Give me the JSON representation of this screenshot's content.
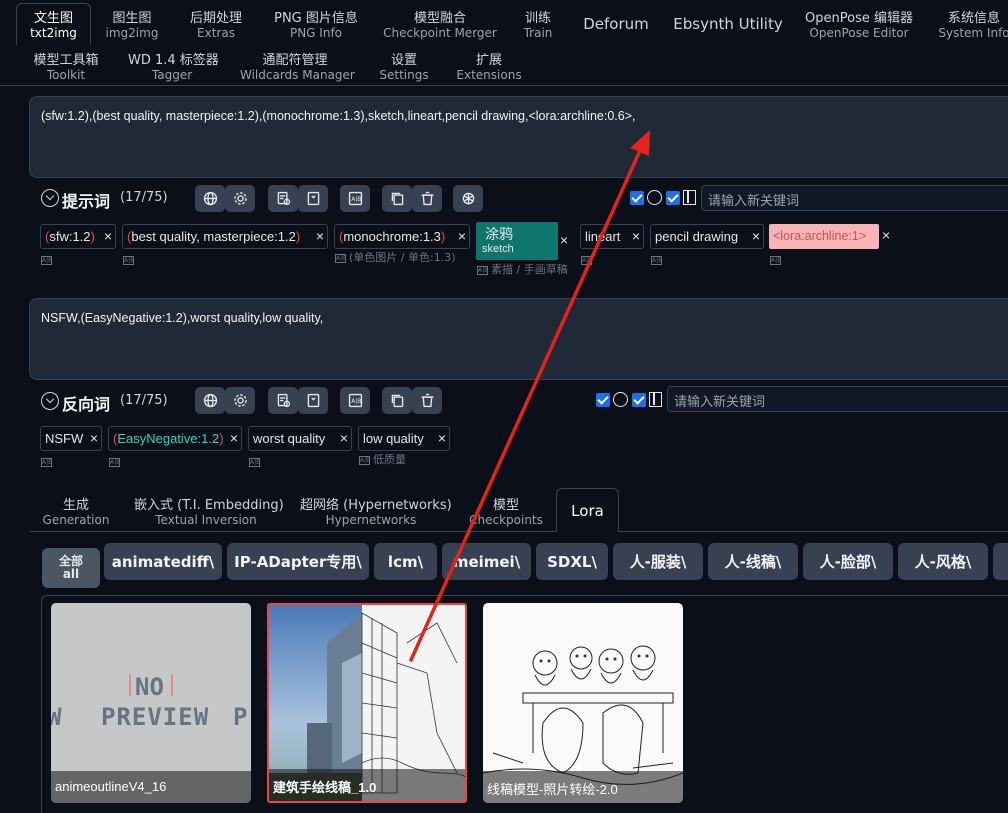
{
  "top_tabs": [
    {
      "zh": "文生图",
      "en": "txt2img"
    },
    {
      "zh": "图生图",
      "en": "img2img"
    },
    {
      "zh": "后期处理",
      "en": "Extras"
    },
    {
      "zh": "PNG 图片信息",
      "en": "PNG Info"
    },
    {
      "zh": "模型融合",
      "en": "Checkpoint Merger"
    },
    {
      "zh": "训练",
      "en": "Train"
    },
    {
      "zh": "Deforum",
      "en": ""
    },
    {
      "zh": "Ebsynth Utility",
      "en": ""
    },
    {
      "zh": "OpenPose 编辑器",
      "en": "OpenPose Editor"
    },
    {
      "zh": "系统信息",
      "en": "System Info"
    }
  ],
  "second_tabs": [
    {
      "zh": "模型工具箱",
      "en": "Toolkit"
    },
    {
      "zh": "WD 1.4 标签器",
      "en": "Tagger"
    },
    {
      "zh": "通配符管理",
      "en": "Wildcards Manager"
    },
    {
      "zh": "设置",
      "en": "Settings"
    },
    {
      "zh": "扩展",
      "en": "Extensions"
    }
  ],
  "prompt": {
    "text": "(sfw:1.2),(best quality, masterpiece:1.2),(monochrome:1.3),sketch,lineart,pencil drawing,<lora:archline:0.6>,",
    "label": "提示词",
    "count": "(17/75)",
    "keyword_placeholder": "请输入新关键词",
    "tags": [
      {
        "pre": "(",
        "text": "sfw:1.2",
        "post": ")",
        "sub": ""
      },
      {
        "pre": "(",
        "text": "best quality, masterpiece:1.2",
        "post": ")",
        "sub": ""
      },
      {
        "pre": "(",
        "text": "monochrome:1.3",
        "post": ")",
        "sub": "(单色图片 / 单色:1.3)"
      },
      {
        "pre": "",
        "text": "涂鸦",
        "post": "",
        "sub": "素描 / 手画草稿",
        "en": "sketch"
      },
      {
        "pre": "",
        "text": "lineart",
        "post": "",
        "sub": ""
      },
      {
        "pre": "",
        "text": "pencil drawing",
        "post": "",
        "sub": ""
      },
      {
        "pre": "",
        "text": "<lora:archline:1>",
        "post": "",
        "sub": ""
      }
    ]
  },
  "negative": {
    "text": "NSFW,(EasyNegative:1.2),worst quality,low quality,",
    "label": "反向词",
    "count": "(17/75)",
    "keyword_placeholder": "请输入新关键词",
    "tags": [
      {
        "pre": "",
        "text": "NSFW",
        "post": "",
        "sub": ""
      },
      {
        "pre": "(",
        "text": "EasyNegative:1.2",
        "post": ")",
        "sub": ""
      },
      {
        "pre": "",
        "text": "worst quality",
        "post": "",
        "sub": ""
      },
      {
        "pre": "",
        "text": "low quality",
        "post": "",
        "sub": "低质量"
      }
    ]
  },
  "network_tabs": [
    {
      "zh": "生成",
      "en": "Generation"
    },
    {
      "zh": "嵌入式 (T.I. Embedding)",
      "en": "Textual Inversion"
    },
    {
      "zh": "超网络 (Hypernetworks)",
      "en": "Hypernetworks"
    },
    {
      "zh": "模型",
      "en": "Checkpoints"
    },
    {
      "zh": "Lora",
      "en": ""
    }
  ],
  "categories": {
    "all_zh": "全部",
    "all_en": "all",
    "items": [
      "animatediff\\",
      "IP-ADapter专用\\",
      "lcm\\",
      "meimei\\",
      "SDXL\\",
      "人-服装\\",
      "人-线稿\\",
      "人-脸部\\",
      "人-风格\\"
    ]
  },
  "cards": [
    {
      "name": "animeoutlineV4_16",
      "no_preview_top": "NO",
      "no_preview_bottom": "PREVIEW"
    },
    {
      "name": "建筑手绘线稿_1.0"
    },
    {
      "name": "线稿模型-照片转绘-2.0"
    }
  ],
  "colors": {
    "accent": "#ef4444",
    "highlight_tag": "#0f766e",
    "lora_tag": "#f8b4b4"
  }
}
